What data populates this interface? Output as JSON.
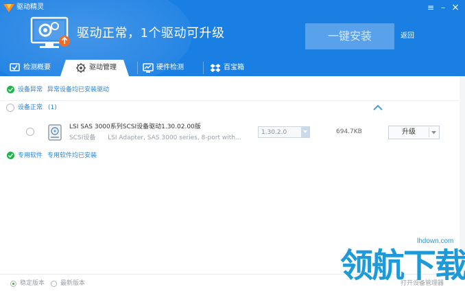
{
  "window": {
    "app_title": "驱动精灵",
    "controls": [
      "menu",
      "minimize",
      "close"
    ]
  },
  "header": {
    "status_title": "驱动正常，1个驱动可升级",
    "onekey_label": "一键安装",
    "back_label": "返回"
  },
  "tabs": [
    {
      "label": "检测概要",
      "icon": "monitor-check-icon",
      "active": false
    },
    {
      "label": "驱动管理",
      "icon": "gear-icon",
      "active": true
    },
    {
      "label": "硬件检测",
      "icon": "hardware-chart-icon",
      "active": false
    },
    {
      "label": "百宝箱",
      "icon": "dropbox-icon",
      "active": false
    }
  ],
  "sections": {
    "abnormal": {
      "title": "设备异常",
      "note": "异常设备均已安装驱动"
    },
    "normal": {
      "title": "设备正常",
      "count": "(1)"
    },
    "special": {
      "title": "专用软件",
      "note": "专用软件均已安装"
    }
  },
  "driver": {
    "name": "LSI SAS 3000系列SCSI设备驱动1.30.02.00版",
    "category": "SCSI设备",
    "description": "LSI Adapter, SAS 3000 series, 8-port with...",
    "version": "1.30.2.0",
    "size": "694.7KB",
    "action_label": "升级"
  },
  "footer": {
    "stable_label": "稳定版本",
    "latest_label": "最新版本",
    "right_label": "打开设备管理器"
  },
  "watermark": {
    "url": "lhdown.com",
    "text": "领航下载"
  },
  "colors": {
    "header_blue": "#1a7fe3",
    "check_green": "#1eb44a",
    "link_blue": "#2a83e0"
  }
}
